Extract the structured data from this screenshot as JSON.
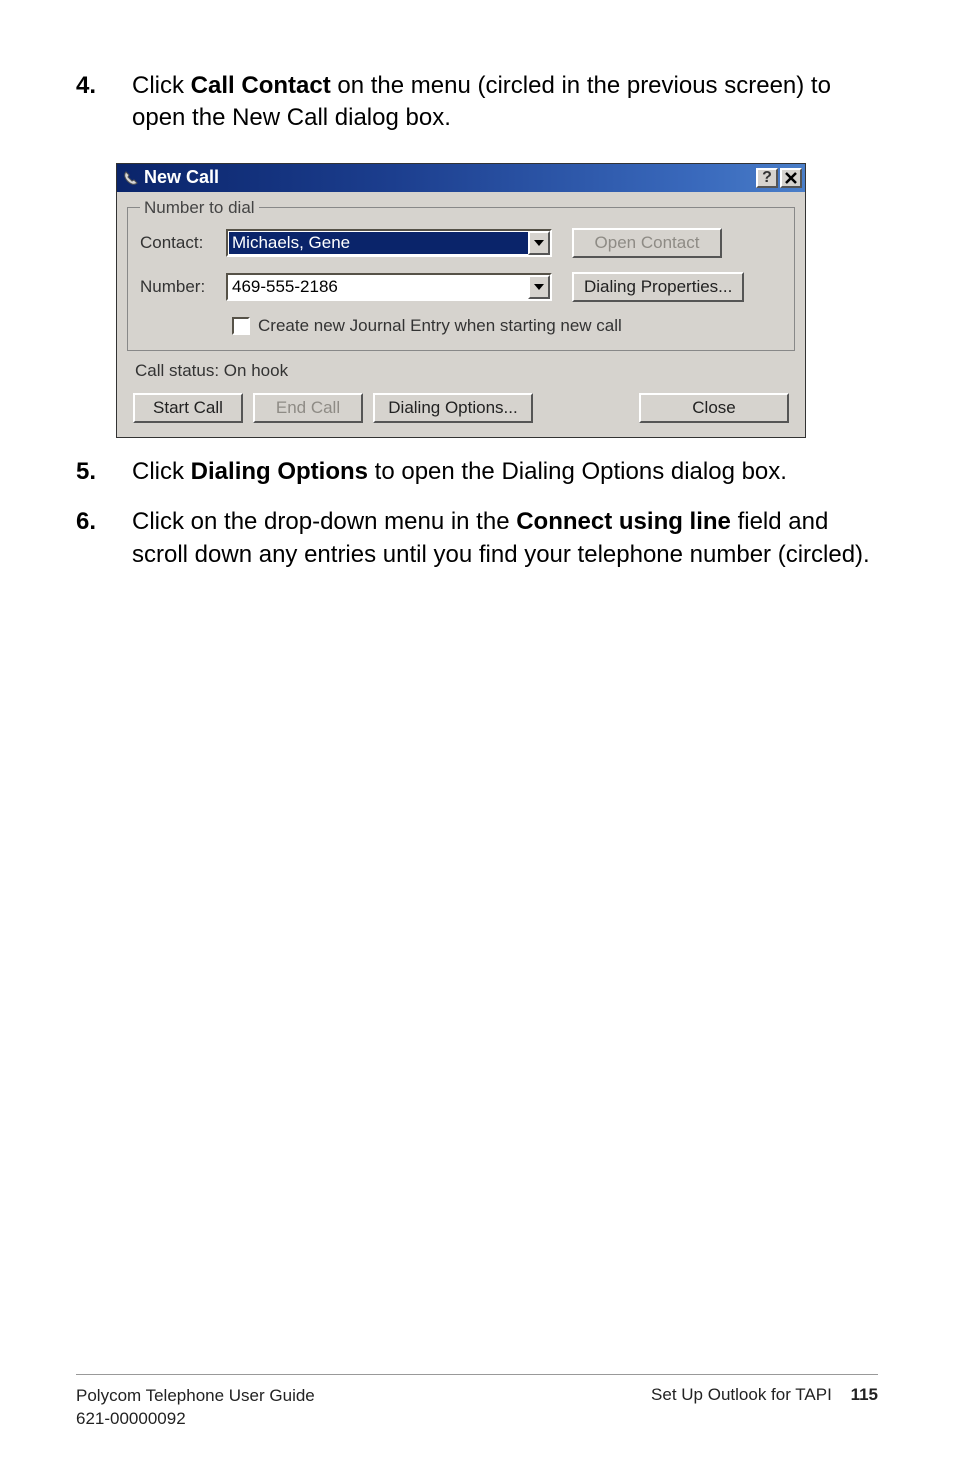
{
  "steps": {
    "s4": {
      "num": "4.",
      "pre": "Click ",
      "bold": "Call Contact",
      "post": " on the menu (circled in the previous screen) to open the New Call dialog box."
    },
    "s5": {
      "num": "5.",
      "pre": "Click ",
      "bold": "Dialing Options",
      "post": " to open the Dialing Options dialog box."
    },
    "s6": {
      "num": "6.",
      "pre": "Click on the drop-down menu in the ",
      "bold": "Connect using line",
      "post": " field and scroll down any entries until you find your telephone number (circled)."
    }
  },
  "dialog": {
    "title": "New Call",
    "group_legend": "Number to dial",
    "contact_label": "Contact:",
    "contact_value": "Michaels, Gene",
    "open_contact": "Open Contact",
    "number_label": "Number:",
    "number_value": "469-555-2186",
    "dialing_properties": "Dialing Properties...",
    "checkbox_label": "Create new Journal Entry when starting new call",
    "call_status": "Call status: On hook",
    "start_call": "Start Call",
    "end_call": "End Call",
    "dialing_options": "Dialing Options...",
    "close": "Close"
  },
  "footer": {
    "left_line1": "Polycom Telephone User Guide",
    "left_line2": "621-00000092",
    "right_text": "Set Up Outlook for TAPI",
    "pageno": "115"
  }
}
